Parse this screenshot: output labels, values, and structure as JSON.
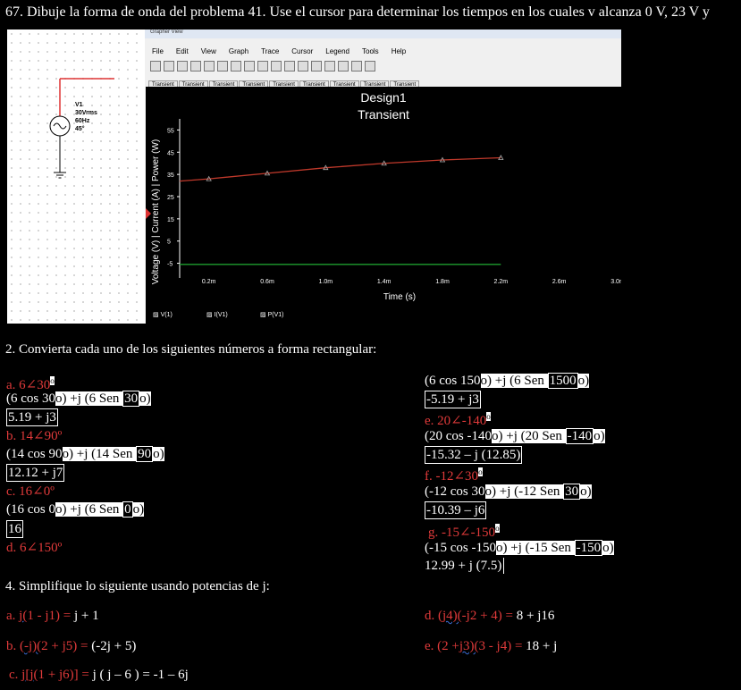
{
  "q67": "67. Dibuje la forma de onda del problema 41. Use el cursor para determinar los tiempos en los cuales v alcanza 0 V, 23 V y",
  "grapher": {
    "window_title": "Grapher View",
    "menu": [
      "File",
      "Edit",
      "View",
      "Graph",
      "Trace",
      "Cursor",
      "Legend",
      "Tools",
      "Help"
    ],
    "tabs": [
      "Transient",
      "Transient",
      "Transient",
      "Transient",
      "Transient",
      "Transient",
      "Transient",
      "Transient",
      "Transient",
      "Transient"
    ],
    "title1": "Design1",
    "title2": "Transient",
    "ylabel": "Voltage (V) | Current (A) | Power (W)",
    "xlabel": "Time (s)",
    "legend": [
      "V(1)",
      "I(V1)",
      "P(V1)"
    ]
  },
  "source": {
    "name": "V1",
    "vrms": "30Vrms",
    "freq": "60Hz",
    "phase": "45°"
  },
  "chart_data": {
    "type": "line",
    "xlabel": "Time (s)",
    "ylabel": "Voltage (V) | Current (A) | Power (W)",
    "x_ticks": [
      "0.2m",
      "0.6m",
      "1.0m",
      "1.4m",
      "1.8m",
      "2.2m",
      "2.6m",
      "3.0m"
    ],
    "y_ticks": [
      "55",
      "45",
      "35",
      "25",
      "15",
      "5",
      "-5"
    ],
    "xlim": [
      0,
      0.003
    ],
    "ylim": [
      -10,
      60
    ],
    "series": [
      {
        "name": "V(1)",
        "color": "#c0392b",
        "x": [
          0,
          0.0002,
          0.0006,
          0.001,
          0.0014,
          0.0018,
          0.0022
        ],
        "y": [
          32,
          33,
          35.5,
          38,
          40,
          41.5,
          42.5
        ]
      },
      {
        "name": "I(V1)",
        "color": "#1e9e2e",
        "x": [
          0,
          0.0022
        ],
        "y": [
          -5.5,
          -5.5
        ]
      }
    ]
  },
  "sec2_title": "2. Convierta cada uno de los siguientes números a forma rectangular:",
  "left2": {
    "a_head": "a. 6∠30",
    "a_sup": "o",
    "a_l1a": "(6 cos 30",
    "a_l1b": "o) +j (6 Sen ",
    "a_l1c": "30",
    "a_l1d": "o)",
    "a_res": "5.19 + j3",
    "b_head": "b. 14∠90º",
    "b_l1a": "(14 cos 90",
    "b_l1b": "o) +j (14 Sen ",
    "b_l1c": "90",
    "b_l1d": "o)",
    "b_res": "12.12 + j7",
    "c_head": "c. 16∠0º",
    "c_l1a": "(16 cos 0",
    "c_l1b": "o) +j (6 Sen ",
    "c_l1c": "0",
    "c_l1d": "o)",
    "c_res": "16",
    "d_head": "d. 6∠150º"
  },
  "right2": {
    "l1a": "(6 cos 150",
    "l1b": "o) +j (6 Sen ",
    "l1c": "1500",
    "l1d": "o)",
    "r1": "-5.19 + j3",
    "e_head": "e. 20∠-140",
    "e_sup": "o",
    "l2a": "(20 cos -140",
    "l2b": "o) +j (20 Sen ",
    "l2c": "-140",
    "l2d": "o)",
    "r2": "-15.32 – j (12.85)",
    "f_head": "f. -12∠30",
    "f_sup": "o",
    "l3a": "(-12 cos 30",
    "l3b": "o) +j (-12 Sen ",
    "l3c": "30",
    "l3d": "o)",
    "r3": "-10.39 – j6",
    "g_head": "g. -15∠-150",
    "g_sup": "o",
    "l4a": "(-15 cos -150",
    "l4b": "o) +j (-15 Sen ",
    "l4c": "-150",
    "l4d": "o)",
    "r4": "12.99 + j (7.5)"
  },
  "sec4_title": "4. Simplifique lo siguiente usando potencias de j:",
  "sec4": {
    "a_pre": "a. ",
    "a_sq": "j(",
    "a_mid": "1 - j1) = ",
    "a_res": "j + 1",
    "b_pre": "b. (",
    "b_sq": "-j)(",
    "b_mid": "2 + j5) = ",
    "b_res": "(-2j + 5)",
    "c_pre": "c. ",
    "c_sq": "j[j",
    "c_mid": "(1 + j6)] = ",
    "c_res": "j ( j – 6 ) = -1 – 6j",
    "d_pre": "d. (",
    "d_sq": "j4)(",
    "d_mid": "-j2 + 4) = ",
    "d_res": " 8 + j16",
    "e_pre": "e. (2 +",
    "e_sq": "j3)(",
    "e_mid": "3 - j4) = ",
    "e_res": "18 + j"
  }
}
